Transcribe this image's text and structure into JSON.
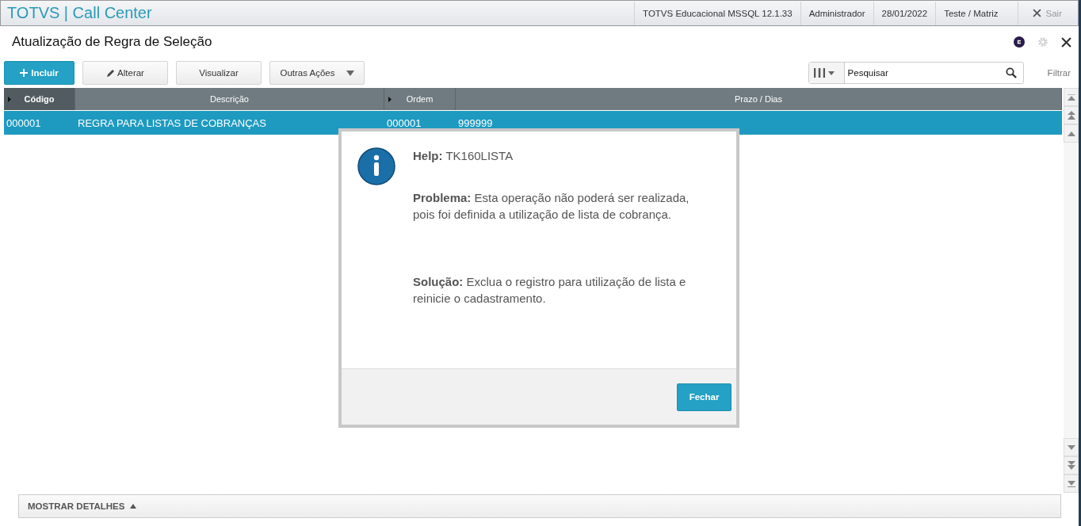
{
  "app_title": "TOTVS | Call Center",
  "header_info": [
    "TOTVS Educacional MSSQL 12.1.33",
    "Administrador",
    "28/01/2022",
    "Teste / Matriz"
  ],
  "exit_label": "Sair",
  "page_title": "Atualização de Regra de Seleção",
  "toolbar": [
    {
      "label": "Incluir",
      "kind": "primary"
    },
    {
      "label": "Alterar",
      "kind": "edit"
    },
    {
      "label": "Visualizar",
      "kind": "plain"
    },
    {
      "label": "Outras Ações",
      "kind": "menu"
    }
  ],
  "search": {
    "placeholder": "Pesquisar"
  },
  "filter_label": "Filtrar",
  "table": {
    "columns": [
      {
        "label": "Código",
        "sorted": true
      },
      {
        "label": "Descrição",
        "sorted": false
      },
      {
        "label": "Ordem",
        "sorted": true
      },
      {
        "label": "Prazo / Dias",
        "sorted": false
      }
    ],
    "rows": [
      {
        "cells": [
          "000001",
          "REGRA PARA LISTAS DE COBRANÇAS",
          "000001",
          "999999"
        ],
        "selected": true
      }
    ]
  },
  "dialog": {
    "title": "**Help:** TK160LISTA",
    "problem": "**Problema:** Esta operação não poderá ser realizada, pois foi definida a utilização de lista de cobrança.",
    "solution": "**Solução:** Exclua o registro para utilização de lista e reinicie o cadastramento.",
    "button": "Fechar"
  },
  "details_label": "MOSTRAR DETALHES"
}
